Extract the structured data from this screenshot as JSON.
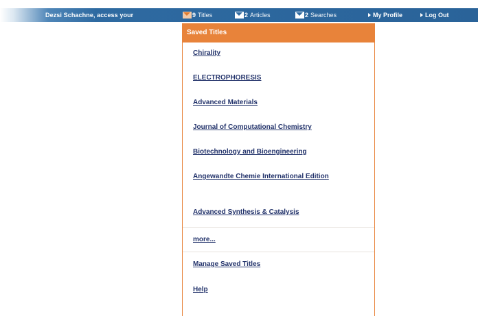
{
  "topbar": {
    "greeting": "Dezsi Schachne, access your",
    "titles": {
      "count": "9",
      "label": "Titles"
    },
    "articles": {
      "count": "2",
      "label": "Articles"
    },
    "searches": {
      "count": "2",
      "label": "Searches"
    },
    "my_profile": "My Profile",
    "log_out": "Log Out"
  },
  "dropdown": {
    "header": "Saved Titles",
    "titles": [
      "Chirality",
      "ELECTROPHORESIS",
      "Advanced Materials",
      "Journal of Computational Chemistry",
      "Biotechnology and Bioengineering",
      "Angewandte Chemie International Edition",
      "Advanced Synthesis & Catalysis"
    ],
    "more": "more...",
    "manage": "Manage Saved Titles",
    "help": "Help"
  },
  "colors": {
    "accent_orange": "#e8833a",
    "bar_blue": "#2e6aa1",
    "link_navy": "#23336b"
  },
  "icons": [
    "envelope-icon",
    "arrow-right-icon"
  ]
}
